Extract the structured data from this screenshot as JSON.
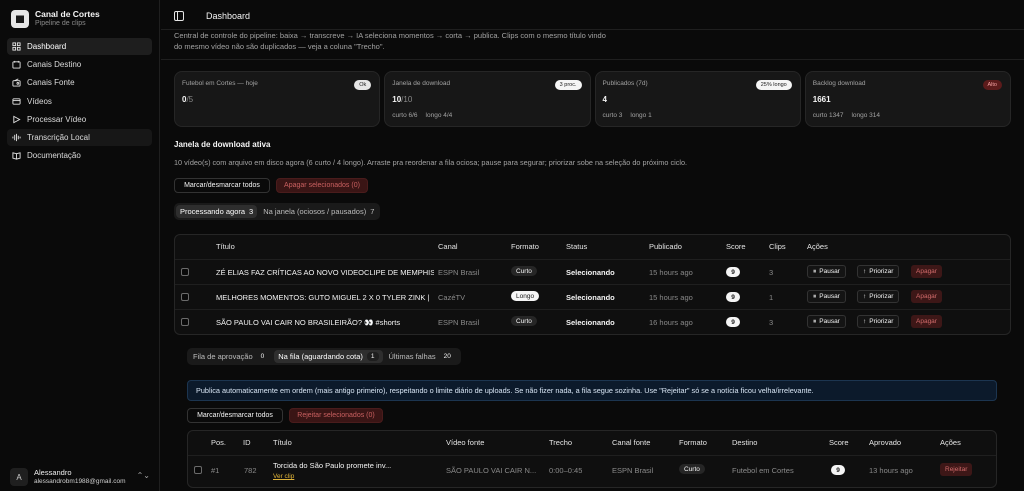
{
  "brand": {
    "title": "Canal de Cortes",
    "subtitle": "Pipeline de clips"
  },
  "sidebar": {
    "items": [
      {
        "label": "Dashboard",
        "icon": "grid-icon",
        "active": true
      },
      {
        "label": "Canais Destino",
        "icon": "calendar-icon"
      },
      {
        "label": "Canais Fonte",
        "icon": "radio-icon"
      },
      {
        "label": "Vídeos",
        "icon": "video-icon"
      },
      {
        "label": "Processar Vídeo",
        "icon": "play-icon"
      },
      {
        "label": "Transcrição Local",
        "icon": "waveform-icon"
      },
      {
        "label": "Documentação",
        "icon": "book-icon"
      }
    ]
  },
  "user": {
    "initial": "A",
    "name": "Alessandro",
    "email": "alessandrobm1988@gmail.com"
  },
  "header": {
    "title": "Dashboard"
  },
  "intro": "Central de controle do pipeline: baixa → transcreve → IA seleciona momentos → corta → publica. Clips com o mesmo título vindo do mesmo vídeo não são duplicados — veja a coluna \"Trecho\".",
  "cards": [
    {
      "label": "Futebol em Cortes — hoje",
      "value": "0",
      "value_dim": "/5",
      "badge": "Ok",
      "badge_style": "dark",
      "sub": []
    },
    {
      "label": "Janela de download",
      "value": "10",
      "value_dim": "/10",
      "badge": "3 proc.",
      "badge_style": "light",
      "sub": [
        "curto 6/6",
        "longo 4/4"
      ]
    },
    {
      "label": "Publicados (7d)",
      "value": "4",
      "value_dim": "",
      "badge": "25% longo",
      "badge_style": "light",
      "sub": [
        "curto 3",
        "longo 1"
      ]
    },
    {
      "label": "Backlog download",
      "value": "1661",
      "value_dim": "",
      "badge": "Alto",
      "badge_style": "red",
      "sub": [
        "curto 1347",
        "longo 314"
      ]
    }
  ],
  "download_window": {
    "title": "Janela de download ativa",
    "desc": "10 vídeo(s) com arquivo em disco agora (6 curto / 4 longo). Arraste pra reordenar a fila ociosa; pause para segurar; priorizar sobe na seleção do próximo ciclo.",
    "toggle_all": "Marcar/desmarcar todos",
    "delete_selected": "Apagar selecionados (0)",
    "tabs": [
      {
        "label": "Processando agora",
        "count": "3",
        "active": true
      },
      {
        "label": "Na janela (ociosos / pausados)",
        "count": "7",
        "active": false
      }
    ],
    "columns": [
      "Título",
      "Canal",
      "Formato",
      "Status",
      "Publicado",
      "Score",
      "Clips",
      "Ações"
    ],
    "rows": [
      {
        "title": "ZÉ ELIAS FAZ CRÍTICAS AO NOVO VIDEOCLIPE DE MEMPHIS",
        "channel": "ESPN Brasil",
        "format": "Curto",
        "status": "Selecionando",
        "published": "15 hours ago",
        "score": "9",
        "clips": "3"
      },
      {
        "title": "MELHORES MOMENTOS: GUTO MIGUEL 2 X 0 TYLER ZINK |",
        "channel": "CazéTV",
        "format": "Longo",
        "status": "Selecionando",
        "published": "15 hours ago",
        "score": "9",
        "clips": "1"
      },
      {
        "title": "SÃO PAULO VAI CAIR NO BRASILEIRÃO? 👀 #shorts",
        "channel": "ESPN Brasil",
        "format": "Curto",
        "status": "Selecionando",
        "published": "16 hours ago",
        "score": "9",
        "clips": "3"
      }
    ],
    "actions": {
      "pause": "Pausar",
      "prioritize": "Priorizar",
      "delete": "Apagar"
    }
  },
  "approval": {
    "tabs": [
      {
        "label": "Fila de aprovação",
        "count": "0",
        "active": false
      },
      {
        "label": "Na fila (aguardando cota)",
        "count": "1",
        "active": true
      },
      {
        "label": "Últimas falhas",
        "count": "20",
        "active": false
      }
    ],
    "info": "Publica automaticamente em ordem (mais antigo primeiro), respeitando o limite diário de uploads. Se não fizer nada, a fila segue sozinha. Use \"Rejeitar\" só se a notícia ficou velha/irrelevante.",
    "toggle_all": "Marcar/desmarcar todos",
    "reject_selected": "Rejeitar selecionados (0)",
    "columns": [
      "Pos.",
      "ID",
      "Título",
      "Vídeo fonte",
      "Trecho",
      "Canal fonte",
      "Formato",
      "Destino",
      "Score",
      "Aprovado",
      "Ações"
    ],
    "rows": [
      {
        "pos": "#1",
        "id": "782",
        "title": "Torcida do São Paulo promete inv...",
        "link": "Ver clip",
        "source": "SÃO PAULO VAI CAIR N...",
        "range": "0:00–0:45",
        "channel": "ESPN Brasil",
        "format": "Curto",
        "dest": "Futebol em Cortes",
        "score": "9",
        "approved": "13 hours ago",
        "action": "Rejeitar"
      }
    ]
  }
}
